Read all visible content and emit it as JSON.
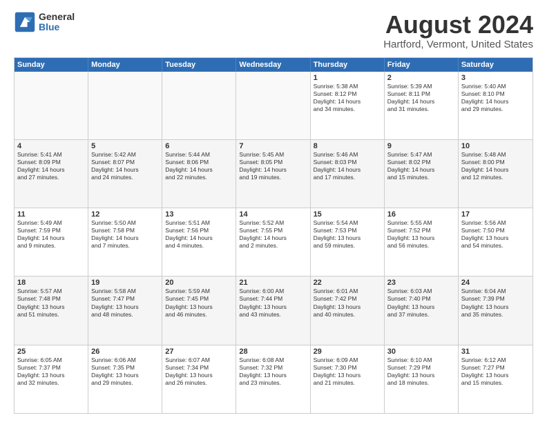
{
  "logo": {
    "general": "General",
    "blue": "Blue"
  },
  "title": "August 2024",
  "location": "Hartford, Vermont, United States",
  "days": [
    "Sunday",
    "Monday",
    "Tuesday",
    "Wednesday",
    "Thursday",
    "Friday",
    "Saturday"
  ],
  "weeks": [
    [
      {
        "day": "",
        "lines": []
      },
      {
        "day": "",
        "lines": []
      },
      {
        "day": "",
        "lines": []
      },
      {
        "day": "",
        "lines": []
      },
      {
        "day": "1",
        "lines": [
          "Sunrise: 5:38 AM",
          "Sunset: 8:12 PM",
          "Daylight: 14 hours",
          "and 34 minutes."
        ]
      },
      {
        "day": "2",
        "lines": [
          "Sunrise: 5:39 AM",
          "Sunset: 8:11 PM",
          "Daylight: 14 hours",
          "and 31 minutes."
        ]
      },
      {
        "day": "3",
        "lines": [
          "Sunrise: 5:40 AM",
          "Sunset: 8:10 PM",
          "Daylight: 14 hours",
          "and 29 minutes."
        ]
      }
    ],
    [
      {
        "day": "4",
        "lines": [
          "Sunrise: 5:41 AM",
          "Sunset: 8:09 PM",
          "Daylight: 14 hours",
          "and 27 minutes."
        ]
      },
      {
        "day": "5",
        "lines": [
          "Sunrise: 5:42 AM",
          "Sunset: 8:07 PM",
          "Daylight: 14 hours",
          "and 24 minutes."
        ]
      },
      {
        "day": "6",
        "lines": [
          "Sunrise: 5:44 AM",
          "Sunset: 8:06 PM",
          "Daylight: 14 hours",
          "and 22 minutes."
        ]
      },
      {
        "day": "7",
        "lines": [
          "Sunrise: 5:45 AM",
          "Sunset: 8:05 PM",
          "Daylight: 14 hours",
          "and 19 minutes."
        ]
      },
      {
        "day": "8",
        "lines": [
          "Sunrise: 5:46 AM",
          "Sunset: 8:03 PM",
          "Daylight: 14 hours",
          "and 17 minutes."
        ]
      },
      {
        "day": "9",
        "lines": [
          "Sunrise: 5:47 AM",
          "Sunset: 8:02 PM",
          "Daylight: 14 hours",
          "and 15 minutes."
        ]
      },
      {
        "day": "10",
        "lines": [
          "Sunrise: 5:48 AM",
          "Sunset: 8:00 PM",
          "Daylight: 14 hours",
          "and 12 minutes."
        ]
      }
    ],
    [
      {
        "day": "11",
        "lines": [
          "Sunrise: 5:49 AM",
          "Sunset: 7:59 PM",
          "Daylight: 14 hours",
          "and 9 minutes."
        ]
      },
      {
        "day": "12",
        "lines": [
          "Sunrise: 5:50 AM",
          "Sunset: 7:58 PM",
          "Daylight: 14 hours",
          "and 7 minutes."
        ]
      },
      {
        "day": "13",
        "lines": [
          "Sunrise: 5:51 AM",
          "Sunset: 7:56 PM",
          "Daylight: 14 hours",
          "and 4 minutes."
        ]
      },
      {
        "day": "14",
        "lines": [
          "Sunrise: 5:52 AM",
          "Sunset: 7:55 PM",
          "Daylight: 14 hours",
          "and 2 minutes."
        ]
      },
      {
        "day": "15",
        "lines": [
          "Sunrise: 5:54 AM",
          "Sunset: 7:53 PM",
          "Daylight: 13 hours",
          "and 59 minutes."
        ]
      },
      {
        "day": "16",
        "lines": [
          "Sunrise: 5:55 AM",
          "Sunset: 7:52 PM",
          "Daylight: 13 hours",
          "and 56 minutes."
        ]
      },
      {
        "day": "17",
        "lines": [
          "Sunrise: 5:56 AM",
          "Sunset: 7:50 PM",
          "Daylight: 13 hours",
          "and 54 minutes."
        ]
      }
    ],
    [
      {
        "day": "18",
        "lines": [
          "Sunrise: 5:57 AM",
          "Sunset: 7:48 PM",
          "Daylight: 13 hours",
          "and 51 minutes."
        ]
      },
      {
        "day": "19",
        "lines": [
          "Sunrise: 5:58 AM",
          "Sunset: 7:47 PM",
          "Daylight: 13 hours",
          "and 48 minutes."
        ]
      },
      {
        "day": "20",
        "lines": [
          "Sunrise: 5:59 AM",
          "Sunset: 7:45 PM",
          "Daylight: 13 hours",
          "and 46 minutes."
        ]
      },
      {
        "day": "21",
        "lines": [
          "Sunrise: 6:00 AM",
          "Sunset: 7:44 PM",
          "Daylight: 13 hours",
          "and 43 minutes."
        ]
      },
      {
        "day": "22",
        "lines": [
          "Sunrise: 6:01 AM",
          "Sunset: 7:42 PM",
          "Daylight: 13 hours",
          "and 40 minutes."
        ]
      },
      {
        "day": "23",
        "lines": [
          "Sunrise: 6:03 AM",
          "Sunset: 7:40 PM",
          "Daylight: 13 hours",
          "and 37 minutes."
        ]
      },
      {
        "day": "24",
        "lines": [
          "Sunrise: 6:04 AM",
          "Sunset: 7:39 PM",
          "Daylight: 13 hours",
          "and 35 minutes."
        ]
      }
    ],
    [
      {
        "day": "25",
        "lines": [
          "Sunrise: 6:05 AM",
          "Sunset: 7:37 PM",
          "Daylight: 13 hours",
          "and 32 minutes."
        ]
      },
      {
        "day": "26",
        "lines": [
          "Sunrise: 6:06 AM",
          "Sunset: 7:35 PM",
          "Daylight: 13 hours",
          "and 29 minutes."
        ]
      },
      {
        "day": "27",
        "lines": [
          "Sunrise: 6:07 AM",
          "Sunset: 7:34 PM",
          "Daylight: 13 hours",
          "and 26 minutes."
        ]
      },
      {
        "day": "28",
        "lines": [
          "Sunrise: 6:08 AM",
          "Sunset: 7:32 PM",
          "Daylight: 13 hours",
          "and 23 minutes."
        ]
      },
      {
        "day": "29",
        "lines": [
          "Sunrise: 6:09 AM",
          "Sunset: 7:30 PM",
          "Daylight: 13 hours",
          "and 21 minutes."
        ]
      },
      {
        "day": "30",
        "lines": [
          "Sunrise: 6:10 AM",
          "Sunset: 7:29 PM",
          "Daylight: 13 hours",
          "and 18 minutes."
        ]
      },
      {
        "day": "31",
        "lines": [
          "Sunrise: 6:12 AM",
          "Sunset: 7:27 PM",
          "Daylight: 13 hours",
          "and 15 minutes."
        ]
      }
    ]
  ]
}
